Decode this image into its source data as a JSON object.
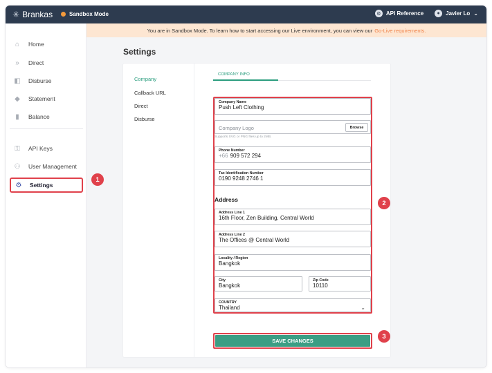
{
  "topbar": {
    "brand": "Brankas",
    "sandbox_label": "Sandbox Mode",
    "api_reference": "API Reference",
    "user_name": "Javier Lo"
  },
  "sidebar": {
    "items": [
      {
        "label": "Home",
        "icon": "home-icon"
      },
      {
        "label": "Direct",
        "icon": "chevrons-right-icon"
      },
      {
        "label": "Disburse",
        "icon": "disburse-icon"
      },
      {
        "label": "Statement",
        "icon": "cube-icon"
      },
      {
        "label": "Balance",
        "icon": "bar-chart-icon"
      },
      {
        "label": "API Keys",
        "icon": "key-icon"
      },
      {
        "label": "User Management",
        "icon": "users-icon"
      },
      {
        "label": "Settings",
        "icon": "gear-icon"
      }
    ]
  },
  "banner": {
    "text": "You are in Sandbox Mode. To learn how to start accessing our Live environment, you can view our",
    "link": "Go-Live requirements."
  },
  "page": {
    "title": "Settings"
  },
  "settings_menu": {
    "items": [
      "Company",
      "Callback URL",
      "Direct",
      "Disburse"
    ]
  },
  "tab": {
    "label": "COMPANY INFO"
  },
  "form": {
    "company_name": {
      "label": "Company Name",
      "value": "Push Left Clothing"
    },
    "company_logo": {
      "placeholder": "Company Logo",
      "browse": "Browse",
      "hint": "Supports SVG or PNG files up to 2MB."
    },
    "phone": {
      "label": "Phone Number",
      "prefix": "+66",
      "value": "909 572 294"
    },
    "tax": {
      "label": "Tax Identification Number",
      "value": "0190 9248 2746 1"
    },
    "address_heading": "Address",
    "address1": {
      "label": "Address Line 1",
      "value": "16th Floor, Zen Building, Central World"
    },
    "address2": {
      "label": "Address Line 2",
      "value": "The Offices @ Central World"
    },
    "locality": {
      "label": "Locality / Region",
      "value": "Bangkok"
    },
    "city": {
      "label": "City",
      "value": "Bangkok"
    },
    "zip": {
      "label": "Zip Code",
      "value": "10110"
    },
    "country": {
      "label": "COUNTRY",
      "value": "Thailand"
    }
  },
  "save_button": "SAVE CHANGES",
  "callouts": [
    "1",
    "2",
    "3"
  ],
  "colors": {
    "topbar": "#2d3b4f",
    "accent": "#2a9d7e",
    "callout": "#e0414b",
    "banner_bg": "#fde6d2",
    "banner_link": "#f0834a"
  }
}
